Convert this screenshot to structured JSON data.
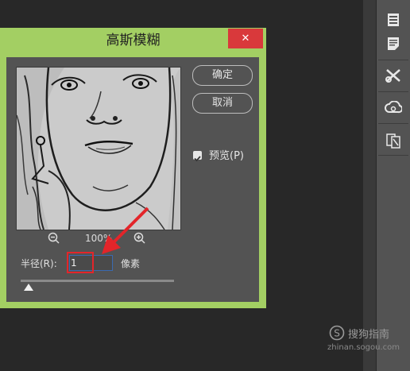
{
  "dialog": {
    "title": "高斯模糊",
    "close_glyph": "✕",
    "ok_label": "确定",
    "cancel_label": "取消",
    "preview_label": "预览(P)",
    "preview_checked": true,
    "zoom_out_icon": "zoom-out-icon",
    "zoom_in_icon": "zoom-in-icon",
    "zoom_level": "100%",
    "radius_label": "半径(R):",
    "radius_value": "1",
    "radius_unit": "像素",
    "colors": {
      "frame": "#a3cf63",
      "close": "#d9393b",
      "panel": "#535353",
      "highlight": "#e3252a"
    }
  },
  "side_tools": [
    "properties-icon",
    "notes-icon",
    "tools-icon",
    "creative-cloud-icon",
    "paths-icon"
  ],
  "watermark": {
    "brand": "搜狗指南",
    "url": "zhinan.sogou.com"
  }
}
